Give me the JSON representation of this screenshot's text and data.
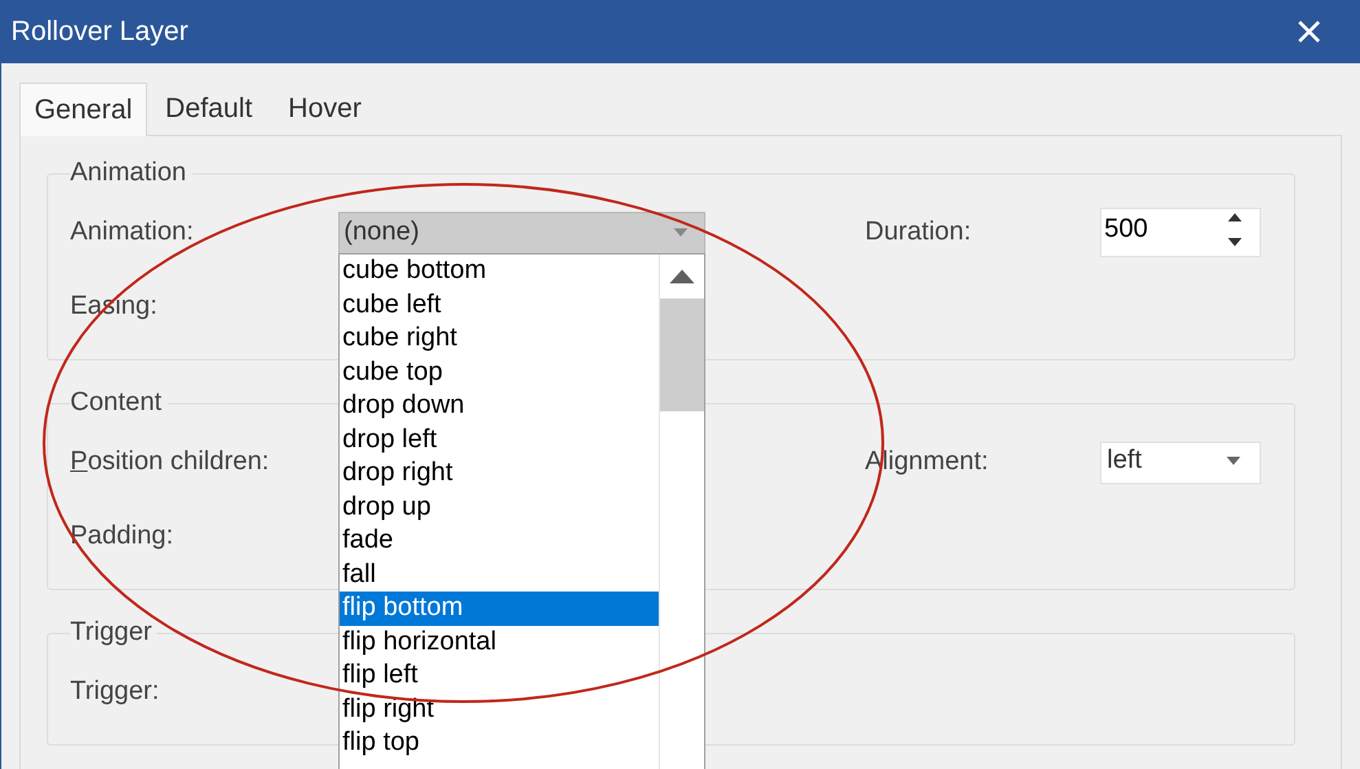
{
  "window": {
    "title": "Rollover Layer"
  },
  "tabs": [
    {
      "label": "General",
      "selected": true
    },
    {
      "label": "Default",
      "selected": false
    },
    {
      "label": "Hover",
      "selected": false
    }
  ],
  "groups": [
    {
      "title": "Animation",
      "rows": [
        {
          "left": {
            "label": "Animation:",
            "kind": "combo",
            "value": "(none)",
            "open": true
          },
          "right": {
            "label": "Duration:",
            "kind": "spin",
            "value": "500"
          }
        },
        {
          "left": {
            "label": "Easing:"
          }
        }
      ]
    },
    {
      "title": "Content",
      "rows": [
        {
          "left": {
            "label": "Position children:",
            "mnemonic": true
          },
          "right": {
            "label": "Alignment:",
            "kind": "dropdown",
            "value": "left"
          }
        },
        {
          "left": {
            "label": "Padding:"
          }
        }
      ]
    },
    {
      "title": "Trigger",
      "rows": [
        {
          "left": {
            "label": "Trigger:"
          }
        }
      ]
    }
  ],
  "dropdown_list": {
    "items": [
      {
        "label": "cube bottom",
        "selected": false
      },
      {
        "label": "cube left",
        "selected": false
      },
      {
        "label": "cube right",
        "selected": false
      },
      {
        "label": "cube top",
        "selected": false
      },
      {
        "label": "drop down",
        "selected": false
      },
      {
        "label": "drop left",
        "selected": false
      },
      {
        "label": "drop right",
        "selected": false
      },
      {
        "label": "drop up",
        "selected": false
      },
      {
        "label": "fade",
        "selected": false
      },
      {
        "label": "fall",
        "selected": false
      },
      {
        "label": "flip bottom",
        "selected": true
      },
      {
        "label": "flip horizontal",
        "selected": false
      },
      {
        "label": "flip left",
        "selected": false
      },
      {
        "label": "flip right",
        "selected": false
      },
      {
        "label": "flip top",
        "selected": false
      }
    ]
  }
}
